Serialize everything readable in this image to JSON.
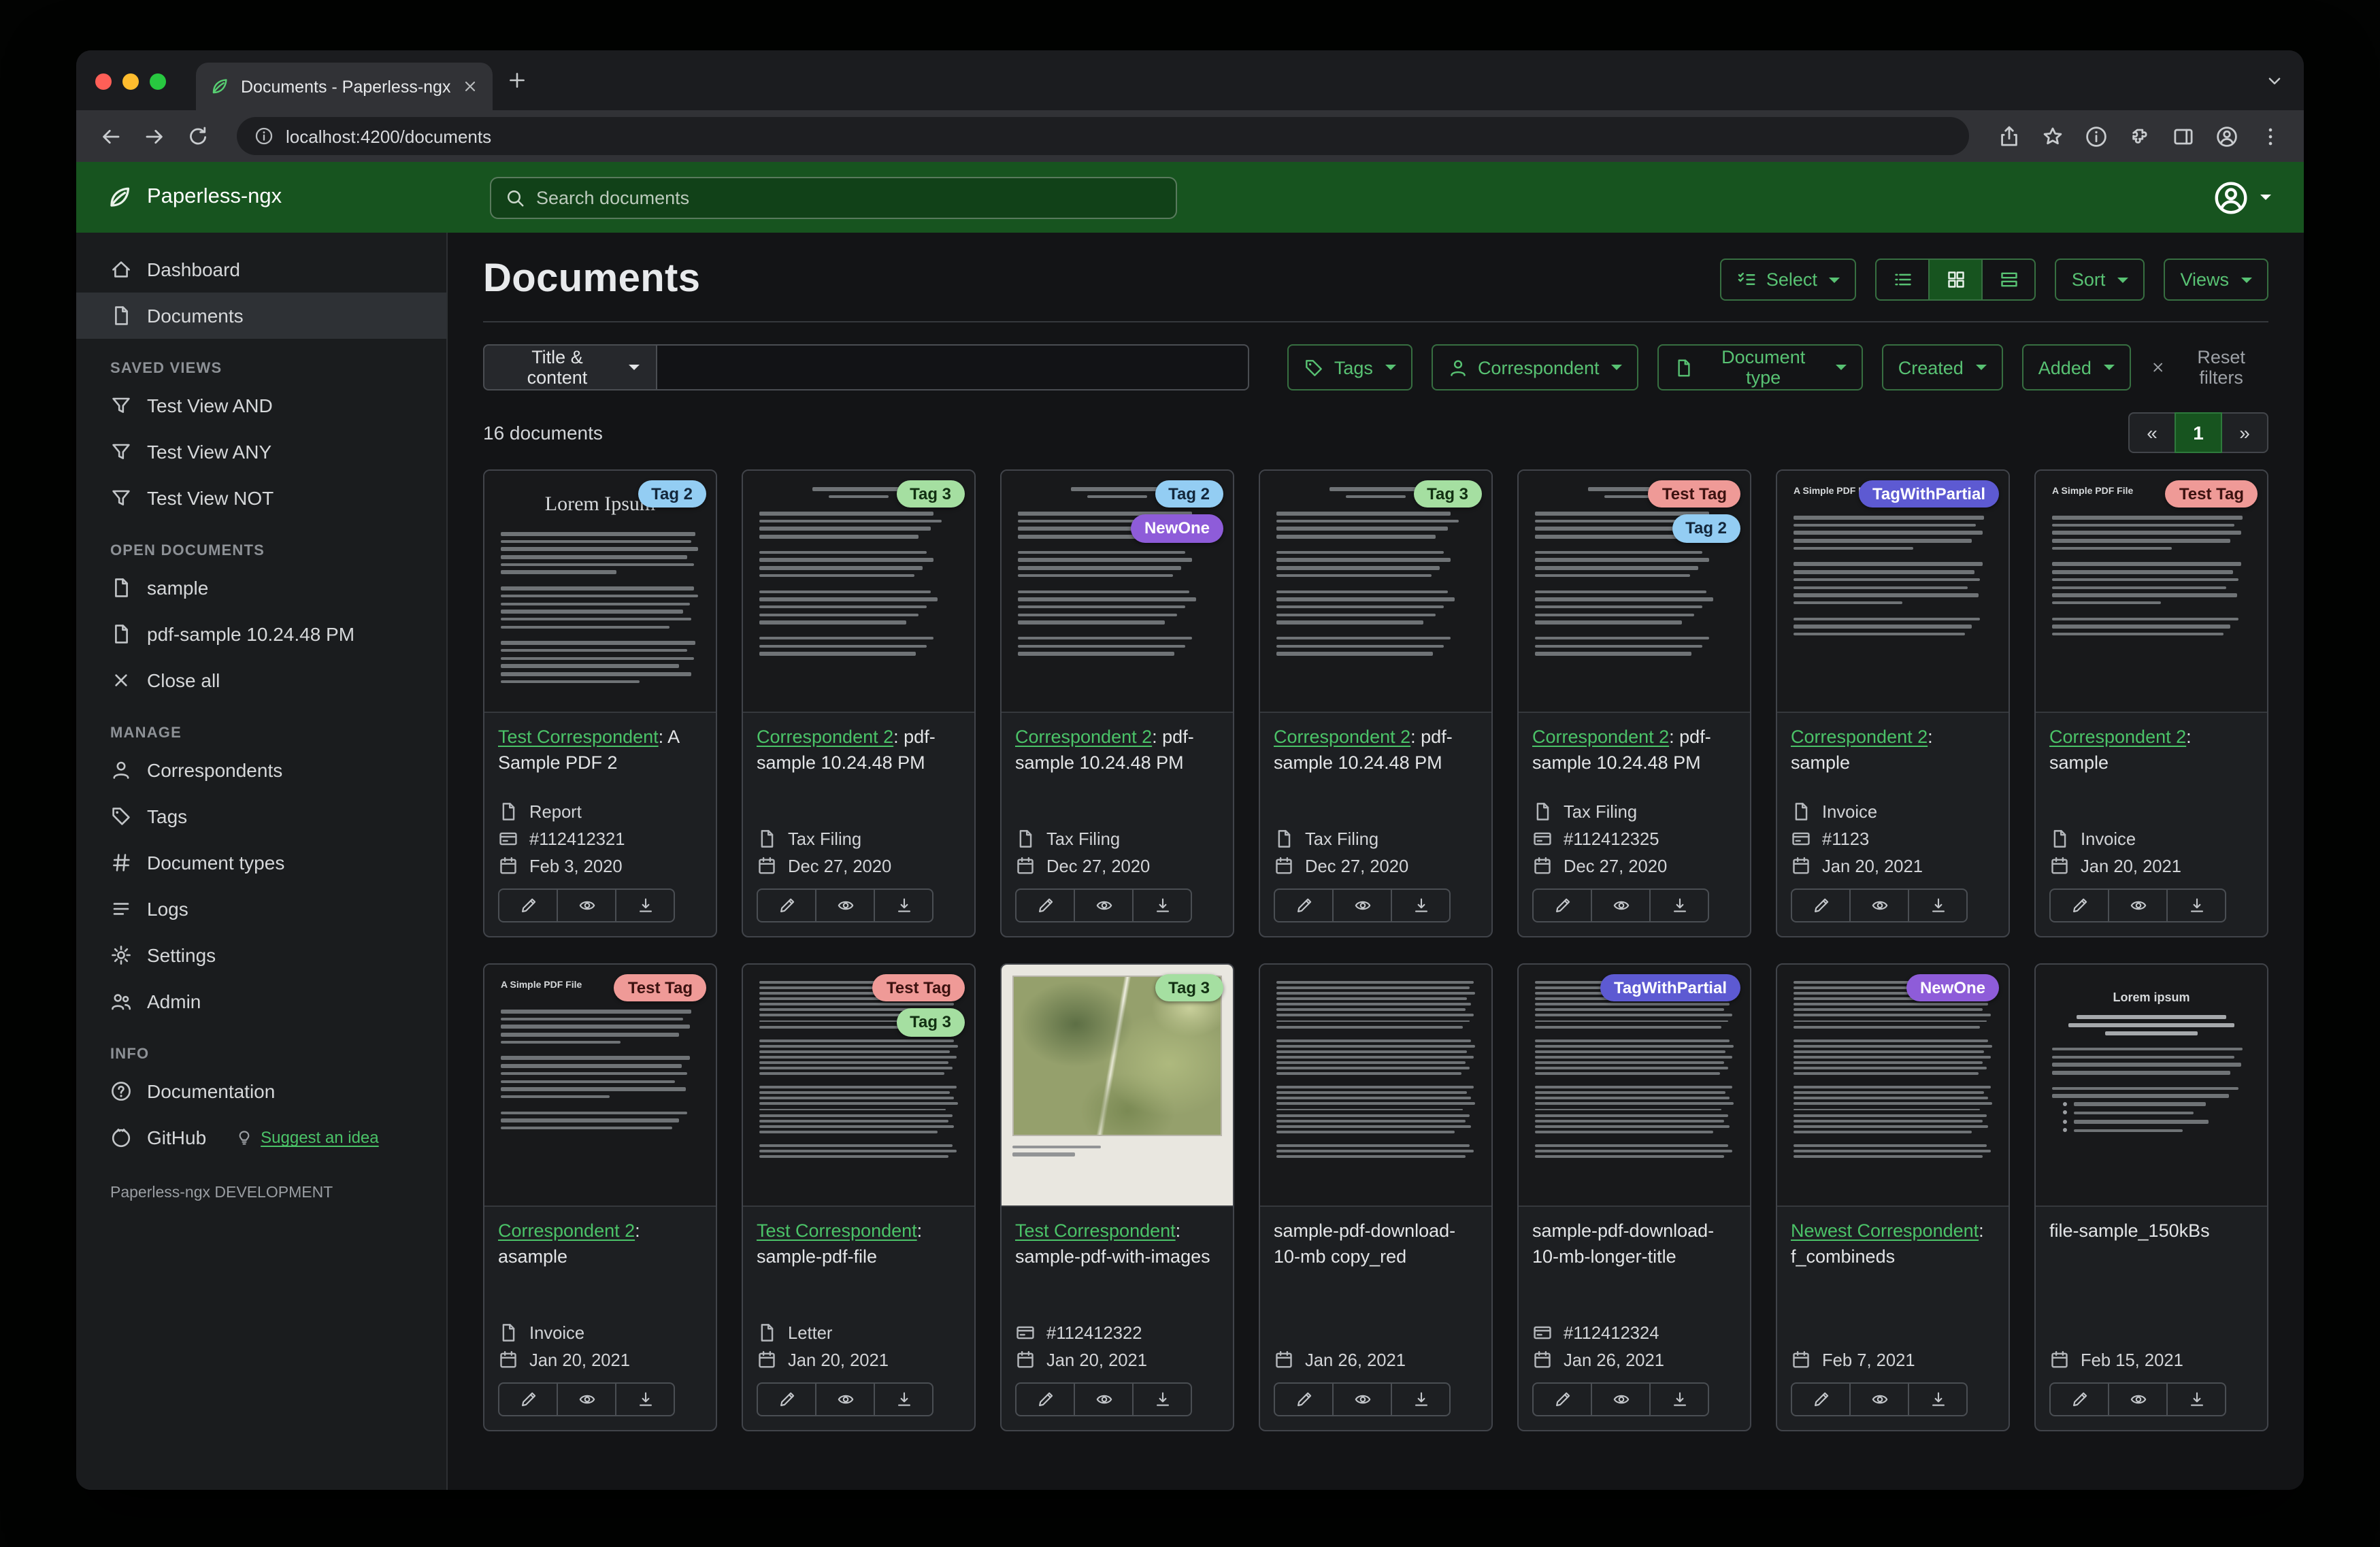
{
  "browser": {
    "tab_title": "Documents - Paperless-ngx",
    "url": "localhost:4200/documents"
  },
  "app_header": {
    "app_name": "Paperless-ngx",
    "search_placeholder": "Search documents"
  },
  "sidebar": {
    "primary": [
      {
        "label": "Dashboard",
        "icon": "house-icon",
        "active": false
      },
      {
        "label": "Documents",
        "icon": "file-icon",
        "active": true
      }
    ],
    "sections": [
      {
        "heading": "SAVED VIEWS",
        "items": [
          {
            "label": "Test View AND",
            "icon": "funnel-icon"
          },
          {
            "label": "Test View ANY",
            "icon": "funnel-icon"
          },
          {
            "label": "Test View NOT",
            "icon": "funnel-icon"
          }
        ]
      },
      {
        "heading": "OPEN DOCUMENTS",
        "items": [
          {
            "label": "sample",
            "icon": "file-icon"
          },
          {
            "label": "pdf-sample 10.24.48 PM",
            "icon": "file-icon"
          },
          {
            "label": "Close all",
            "icon": "close-icon"
          }
        ]
      },
      {
        "heading": "MANAGE",
        "items": [
          {
            "label": "Correspondents",
            "icon": "user-icon"
          },
          {
            "label": "Tags",
            "icon": "tag-icon"
          },
          {
            "label": "Document types",
            "icon": "hash-icon"
          },
          {
            "label": "Logs",
            "icon": "list-icon"
          },
          {
            "label": "Settings",
            "icon": "gear-icon"
          },
          {
            "label": "Admin",
            "icon": "users-icon"
          }
        ]
      },
      {
        "heading": "INFO",
        "items": [
          {
            "label": "Documentation",
            "icon": "question-icon"
          }
        ]
      }
    ],
    "github_label": "GitHub",
    "suggest_label": "Suggest an idea",
    "footer": "Paperless-ngx DEVELOPMENT"
  },
  "main": {
    "title": "Documents",
    "select_label": "Select",
    "sort_label": "Sort",
    "views_label": "Views",
    "filters": {
      "field": "Title & content",
      "tags": "Tags",
      "correspondent": "Correspondent",
      "document_type": "Document type",
      "created": "Created",
      "added": "Added",
      "reset": "Reset filters"
    },
    "count": "16 documents",
    "pagination": {
      "prev": "«",
      "current": "1",
      "next": "»"
    }
  },
  "accent_color": "#4bc368",
  "header_color": "#17541f",
  "tag_colors": {
    "Tag 2": {
      "bg": "#93cdf3",
      "fg": "#13273b"
    },
    "Tag 3": {
      "bg": "#a5dfa1",
      "fg": "#123012"
    },
    "NewOne": {
      "bg": "#8e5cd9",
      "fg": "#ffffff"
    },
    "Test Tag": {
      "bg": "#ef9a97",
      "fg": "#3c1210"
    },
    "TagWithPartial": {
      "bg": "#5d5ad2",
      "fg": "#ffffff"
    }
  },
  "card_meta_icons": {
    "type": "file-icon",
    "asn": "card-icon",
    "date": "calendar-icon"
  },
  "documents": [
    {
      "tags": [
        "Tag 2"
      ],
      "correspondent": "Test Correspondent",
      "title": "A Sample PDF 2",
      "type": "Report",
      "asn": "#112412321",
      "date": "Feb 3, 2020",
      "thumb": {
        "style": "lorem",
        "heading": "Lorem Ipsum"
      }
    },
    {
      "tags": [
        "Tag 3"
      ],
      "correspondent": "Correspondent 2",
      "title": "pdf-sample 10.24.48 PM",
      "type": "Tax Filing",
      "date": "Dec 27, 2020",
      "thumb": {
        "style": "acrobat",
        "heading": ""
      }
    },
    {
      "tags": [
        "Tag 2",
        "NewOne"
      ],
      "correspondent": "Correspondent 2",
      "title": "pdf-sample 10.24.48 PM",
      "type": "Tax Filing",
      "date": "Dec 27, 2020",
      "thumb": {
        "style": "acrobat",
        "heading": ""
      }
    },
    {
      "tags": [
        "Tag 3"
      ],
      "correspondent": "Correspondent 2",
      "title": "pdf-sample 10.24.48 PM",
      "type": "Tax Filing",
      "date": "Dec 27, 2020",
      "thumb": {
        "style": "acrobat",
        "heading": ""
      }
    },
    {
      "tags": [
        "Test Tag",
        "Tag 2"
      ],
      "correspondent": "Correspondent 2",
      "title": "pdf-sample 10.24.48 PM",
      "type": "Tax Filing",
      "asn": "#112412325",
      "date": "Dec 27, 2020",
      "thumb": {
        "style": "acrobat",
        "heading": ""
      }
    },
    {
      "tags": [
        "TagWithPartial"
      ],
      "correspondent": "Correspondent 2",
      "title": "sample",
      "type": "Invoice",
      "asn": "#1123",
      "date": "Jan 20, 2021",
      "thumb": {
        "style": "simple",
        "heading": "A Simple PDF File"
      }
    },
    {
      "tags": [
        "Test Tag"
      ],
      "correspondent": "Correspondent 2",
      "title": "sample",
      "type": "Invoice",
      "date": "Jan 20, 2021",
      "thumb": {
        "style": "simple",
        "heading": "A Simple PDF File"
      }
    },
    {
      "tags": [
        "Test Tag"
      ],
      "correspondent": "Correspondent 2",
      "title": "asample",
      "type": "Invoice",
      "date": "Jan 20, 2021",
      "thumb": {
        "style": "simple",
        "heading": "A Simple PDF File"
      }
    },
    {
      "tags": [
        "Test Tag",
        "Tag 3"
      ],
      "correspondent": "Test Correspondent",
      "title": "sample-pdf-file",
      "type": "Letter",
      "date": "Jan 20, 2021",
      "thumb": {
        "style": "dense",
        "heading": ""
      }
    },
    {
      "tags": [
        "Tag 3"
      ],
      "correspondent": "Test Correspondent",
      "title": "sample-pdf-with-images",
      "asn": "#112412322",
      "date": "Jan 20, 2021",
      "thumb": {
        "style": "map",
        "heading": ""
      }
    },
    {
      "tags": [],
      "title": "sample-pdf-download-10-mb copy_red",
      "date": "Jan 26, 2021",
      "thumb": {
        "style": "dense",
        "heading": ""
      }
    },
    {
      "tags": [
        "TagWithPartial"
      ],
      "title": "sample-pdf-download-10-mb-longer-title",
      "asn": "#112412324",
      "date": "Jan 26, 2021",
      "thumb": {
        "style": "dense",
        "heading": ""
      }
    },
    {
      "tags": [
        "NewOne"
      ],
      "correspondent": "Newest Correspondent",
      "title": "f_combineds",
      "date": "Feb 7, 2021",
      "thumb": {
        "style": "dense",
        "heading": ""
      }
    },
    {
      "tags": [],
      "title": "file-sample_150kBs",
      "date": "Feb 15, 2021",
      "thumb": {
        "style": "loremCenter",
        "heading": "Lorem ipsum"
      }
    }
  ]
}
